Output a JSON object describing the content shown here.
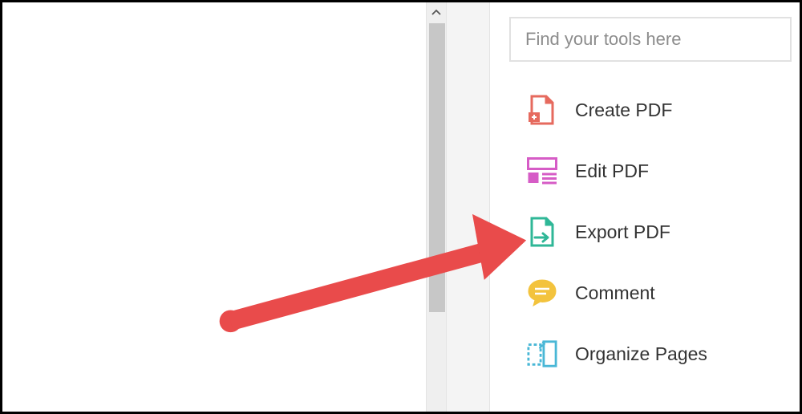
{
  "search": {
    "placeholder": "Find your tools here",
    "value": ""
  },
  "tools": [
    {
      "label": "Create PDF",
      "icon": "create-pdf-icon",
      "color": "#e66a5e"
    },
    {
      "label": "Edit PDF",
      "icon": "edit-pdf-icon",
      "color": "#d65cc6"
    },
    {
      "label": "Export PDF",
      "icon": "export-pdf-icon",
      "color": "#2fb797"
    },
    {
      "label": "Comment",
      "icon": "comment-icon",
      "color": "#f3c33d"
    },
    {
      "label": "Organize Pages",
      "icon": "organize-pages-icon",
      "color": "#49b7d6"
    }
  ],
  "annotation": {
    "arrow_color": "#e94b4b"
  }
}
